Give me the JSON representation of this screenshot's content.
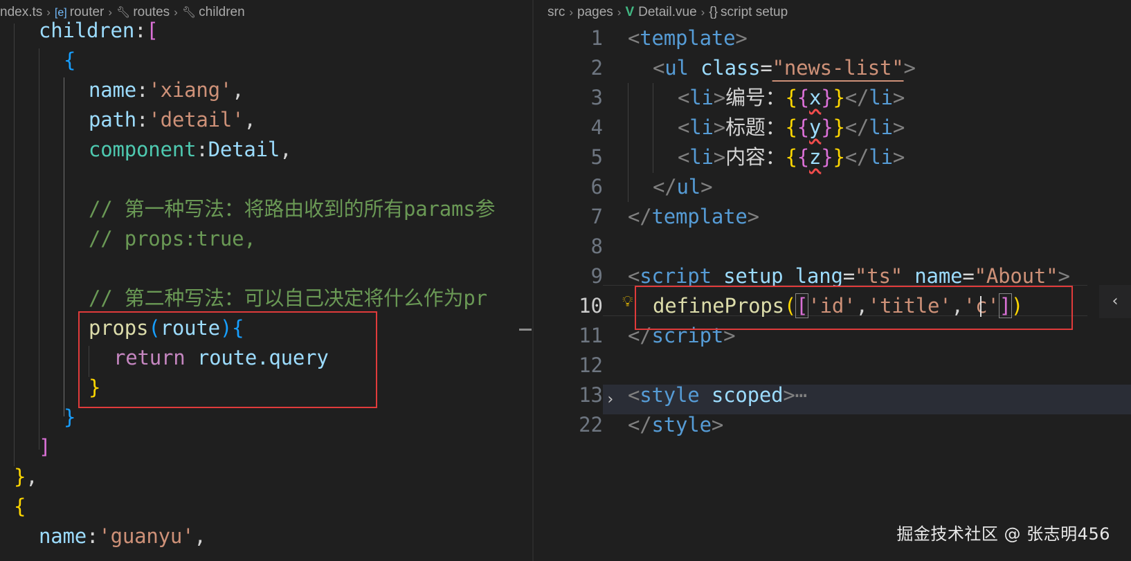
{
  "left": {
    "breadcrumb": [
      "ndex.ts",
      "router",
      "routes",
      "children"
    ],
    "code": {
      "children_key": "children",
      "open_brace": "{",
      "name_key": "name",
      "name_val": "'xiang'",
      "path_key": "path",
      "path_val": "'detail'",
      "component_key": "component",
      "component_val": "Detail",
      "comment1": "// 第一种写法：将路由收到的所有params参",
      "comment2": "// props:true,",
      "comment3": "// 第二种写法：可以自己决定将什么作为pr",
      "props_fn": "props",
      "route_param": "route",
      "return_kw": "return",
      "route_query": "route.query",
      "guanyu_key": "name",
      "guanyu_val": "'guanyu'"
    }
  },
  "right": {
    "breadcrumb": [
      "src",
      "pages",
      "Detail.vue",
      "script setup"
    ],
    "line_numbers": [
      "1",
      "2",
      "3",
      "4",
      "5",
      "6",
      "7",
      "8",
      "9",
      "10",
      "11",
      "12",
      "13",
      "22"
    ],
    "active_line": "10",
    "code": {
      "template_tag": "template",
      "ul_tag": "ul",
      "class_attr": "class",
      "class_val": "\"news-list\"",
      "li_tag": "li",
      "label_id": "编号：",
      "label_title": "标题：",
      "label_content": "内容：",
      "var_x": "x",
      "var_y": "y",
      "var_z": "z",
      "script_tag": "script",
      "setup_attr": "setup",
      "lang_attr": "lang",
      "lang_val": "\"ts\"",
      "name_attr": "name",
      "name_val": "\"About\"",
      "define_fn": "defineProps",
      "arg_id": "'id'",
      "arg_title": "'title'",
      "arg_c_q": "'",
      "arg_c_letter": "c",
      "style_tag": "style",
      "scoped_attr": "scoped",
      "fold_ellipsis": "⋯"
    }
  },
  "watermark": "掘金技术社区 @ 张志明456"
}
